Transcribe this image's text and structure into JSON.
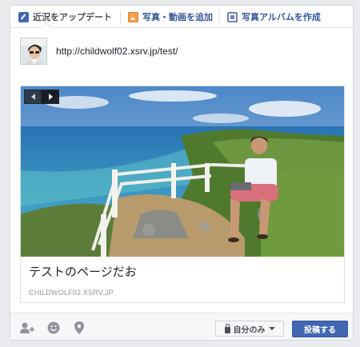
{
  "tabs": [
    {
      "label": "近況をアップデート",
      "icon": "pencil-icon",
      "active": true
    },
    {
      "label": "写真・動画を追加",
      "icon": "photo-icon",
      "active": false
    },
    {
      "label": "写真アルバムを作成",
      "icon": "album-icon",
      "active": false
    }
  ],
  "composer": {
    "post_text": "http://childwolf02.xsrv.jp/test/"
  },
  "link_preview": {
    "title": "テストのページだお",
    "domain": "CHILDWOLF02.XSRV.JP",
    "pager_prev_icon": "arrow-left-icon",
    "pager_next_icon": "arrow-right-icon"
  },
  "footer": {
    "icons": [
      "tag-friends-icon",
      "feeling-icon",
      "location-icon"
    ],
    "privacy_label": "自分のみ",
    "post_label": "投稿する"
  },
  "colors": {
    "accent": "#4267b2",
    "link": "#365899",
    "footer_bg": "#f6f7f9"
  }
}
